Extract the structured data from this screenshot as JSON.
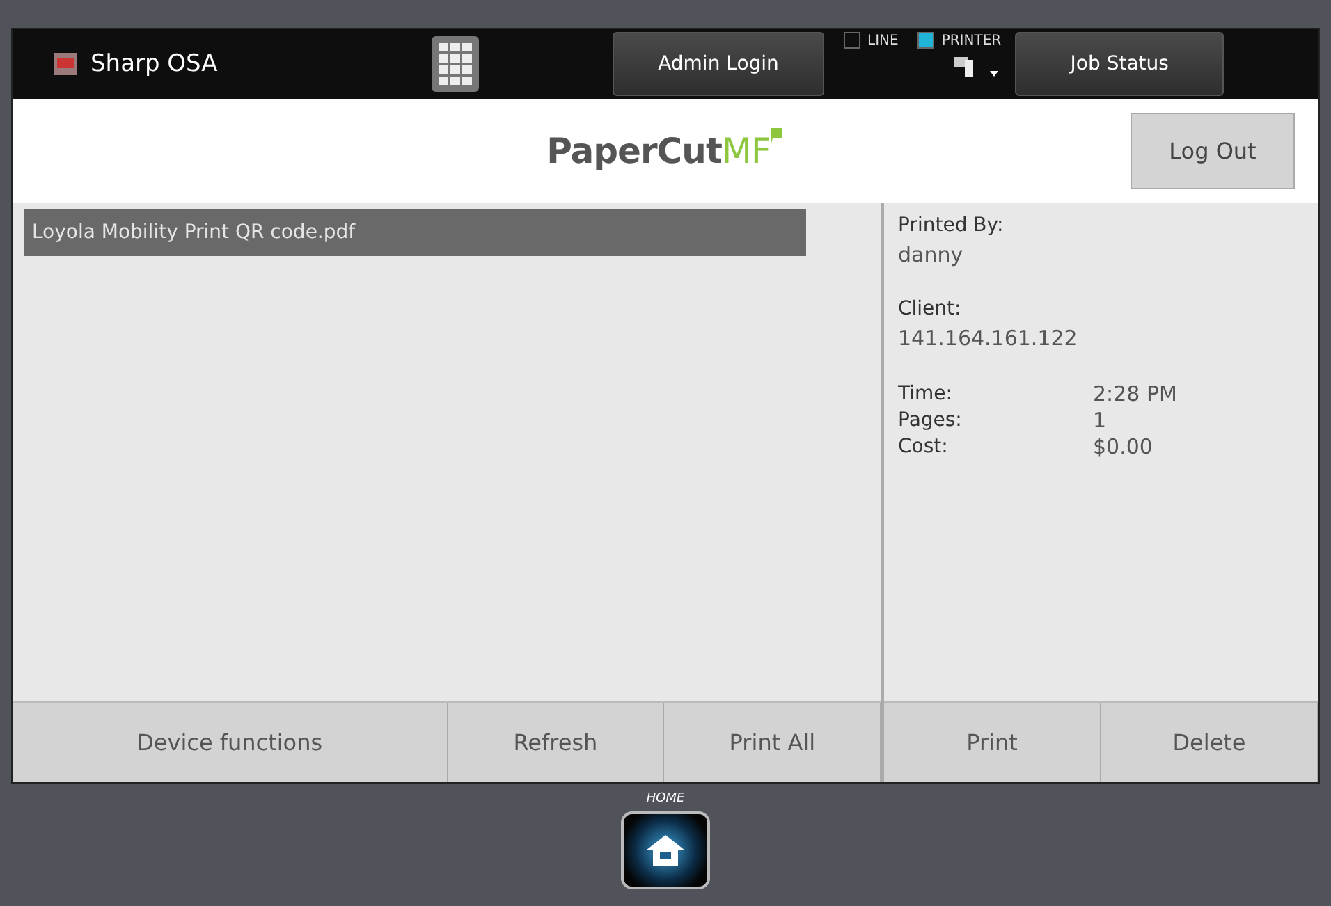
{
  "top_bar": {
    "app_title": "Sharp OSA",
    "admin_button": "Admin Login",
    "indicators": [
      {
        "label": "LINE",
        "checked": false
      },
      {
        "label": "PRINTER",
        "checked": true
      }
    ],
    "job_status_button": "Job Status"
  },
  "header": {
    "logo": {
      "name": "PaperCut",
      "suffix": "MF"
    },
    "logout_button": "Log Out"
  },
  "jobs": [
    {
      "name": "Loyola Mobility Print QR code.pdf",
      "selected": true
    }
  ],
  "details": {
    "groups": [
      {
        "label": "Printed By:",
        "value": "danny"
      },
      {
        "label": "Client:",
        "value": "141.164.161.122"
      }
    ],
    "rows": [
      {
        "label": "Time:",
        "value": "2:28 PM"
      },
      {
        "label": "Pages:",
        "value": "1"
      },
      {
        "label": "Cost:",
        "value": "$0.00"
      }
    ]
  },
  "left_buttons": [
    "Device functions",
    "Refresh",
    "Print All"
  ],
  "right_buttons": [
    "Print",
    "Delete"
  ],
  "home": {
    "label": "HOME"
  }
}
